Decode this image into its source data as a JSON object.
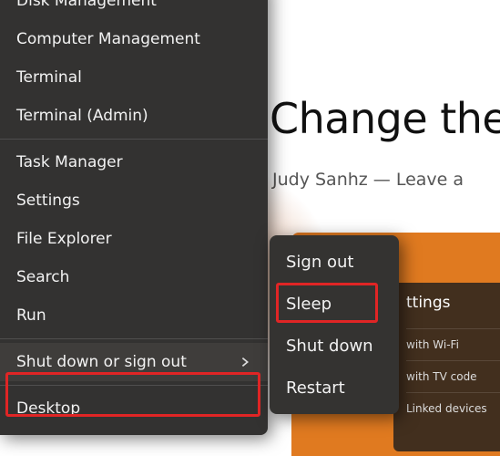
{
  "background": {
    "title_fragment": "Change the",
    "byline_fragment": "Judy Sanhz  —  Leave a",
    "card": {
      "heading": "ttings",
      "rows": [
        "with Wi-Fi",
        "with TV code",
        "Linked devices"
      ]
    }
  },
  "winx_menu": {
    "items_top": [
      "Disk Management",
      "Computer Management",
      "Terminal",
      "Terminal (Admin)"
    ],
    "items_mid": [
      "Task Manager",
      "Settings",
      "File Explorer",
      "Search",
      "Run"
    ],
    "submenu_parent": "Shut down or sign out",
    "items_bottom": [
      "Desktop"
    ]
  },
  "submenu": {
    "items": [
      "Sign out",
      "Sleep",
      "Shut down",
      "Restart"
    ]
  }
}
